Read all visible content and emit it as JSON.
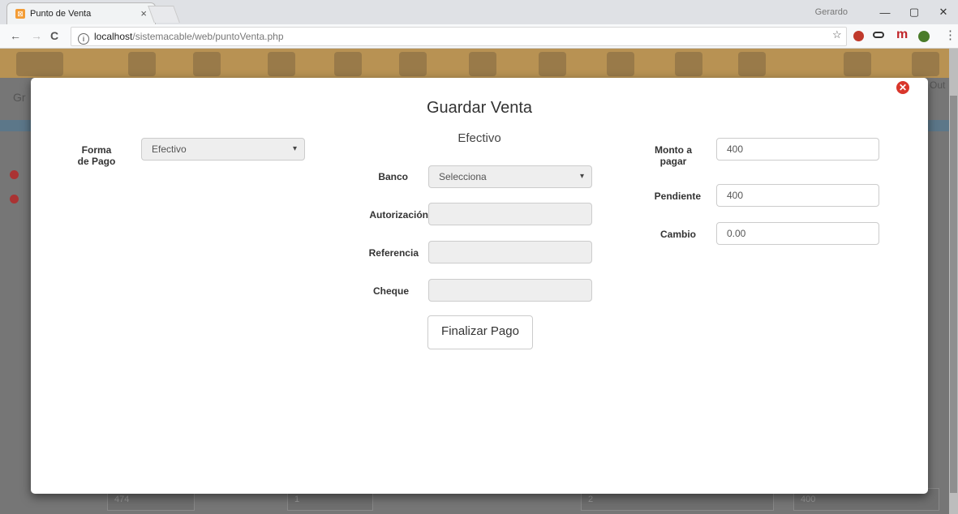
{
  "browser": {
    "tab_title": "Punto de Venta",
    "tab_close": "×",
    "user": "Gerardo",
    "minimize": "—",
    "maximize": "▢",
    "close": "✕",
    "back": "←",
    "forward": "→",
    "reload": "C",
    "url_host": "localhost",
    "url_path": "/sistemacable/web/puntoVenta.php",
    "star": "☆",
    "menu": "⋮",
    "ext_m": "m"
  },
  "background": {
    "gr_text": "Gr",
    "out_text": "Out",
    "row_values": [
      "474",
      "1",
      "2",
      "400"
    ]
  },
  "modal": {
    "title": "Guardar Venta",
    "subtitle": "Efectivo",
    "forma_label_1": "Forma",
    "forma_label_2": "de Pago",
    "forma_value": "Efectivo",
    "banco_label": "Banco",
    "banco_value": "Selecciona",
    "autorizacion_label": "Autorización",
    "referencia_label": "Referencia",
    "cheque_label": "Cheque",
    "finalizar_label": "Finalizar Pago",
    "monto_label_1": "Monto a",
    "monto_label_2": "pagar",
    "monto_value": "400",
    "pendiente_label": "Pendiente",
    "pendiente_value": "400",
    "cambio_label": "Cambio",
    "cambio_value": "0.00"
  },
  "colors": {
    "header_bg": "#b89253",
    "overlay": "#767676",
    "close_red": "#d9362b"
  }
}
